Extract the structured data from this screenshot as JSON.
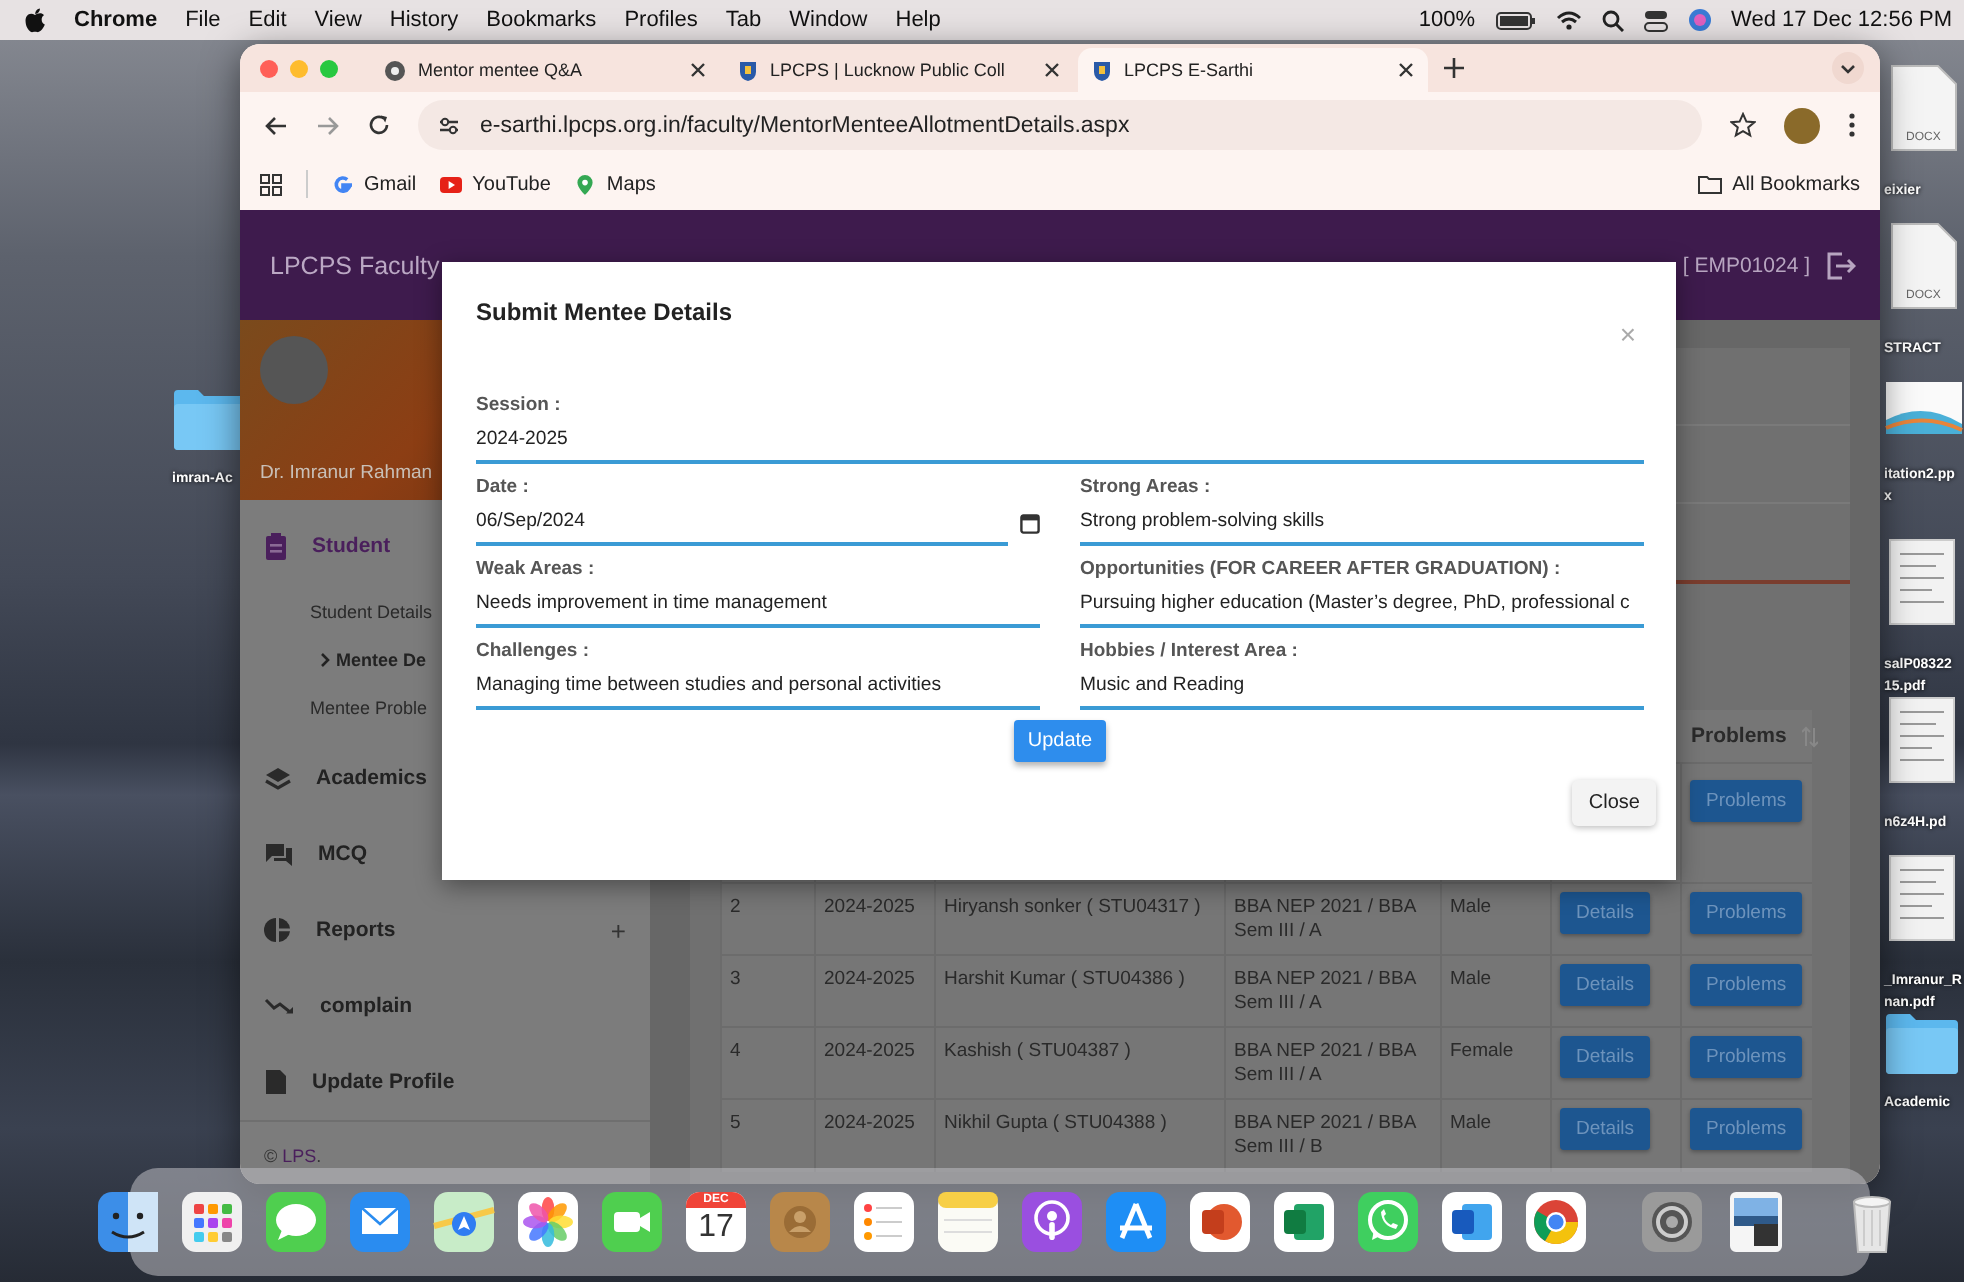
{
  "menu_bar": {
    "app": "Chrome",
    "menus": [
      "File",
      "Edit",
      "View",
      "History",
      "Bookmarks",
      "Profiles",
      "Tab",
      "Window",
      "Help"
    ],
    "battery": "100%",
    "clock": "Wed 17 Dec  12:56 PM"
  },
  "desktop_left": [
    {
      "kind": "folder",
      "label": [
        "imran-Ac"
      ]
    }
  ],
  "desktop_right": [
    {
      "kind": "doc",
      "badge": "DOCX",
      "label": [
        "eixier"
      ]
    },
    {
      "kind": "doc",
      "badge": "DOCX",
      "label": [
        "STRACT"
      ]
    },
    {
      "kind": "slides",
      "label": [
        "itation2.pp",
        "x"
      ]
    },
    {
      "kind": "pdf",
      "label": [
        "salP08322",
        "15.pdf"
      ]
    },
    {
      "kind": "pdf",
      "label": [
        "n6z4H.pd"
      ]
    },
    {
      "kind": "pdf",
      "label": [
        "_Imranur_R",
        "nan.pdf"
      ]
    },
    {
      "kind": "folder",
      "label": [
        "Academic"
      ]
    }
  ],
  "browser": {
    "tabs": [
      {
        "title": "Mentor mentee Q&A",
        "selected": false
      },
      {
        "title": "LPCPS | Lucknow Public Coll",
        "selected": false
      },
      {
        "title": "LPCPS E-Sarthi",
        "selected": true
      }
    ],
    "url": "e-sarthi.lpcps.org.in/faculty/MentorMenteeAllotmentDetails.aspx",
    "bookmarks": [
      "Gmail",
      "YouTube",
      "Maps"
    ],
    "all_bookmarks": "All Bookmarks"
  },
  "page": {
    "brand": "LPCPS Faculty",
    "user_id": "[ EMP01024 ]",
    "profile_name": "Dr. Imranur Rahman",
    "sidebar": [
      {
        "label": "Student",
        "selected": true,
        "children": [
          {
            "label": "Student Details",
            "selected": false
          },
          {
            "label": "Mentee De",
            "selected": true
          },
          {
            "label": "Mentee Proble",
            "selected": false
          }
        ]
      },
      {
        "label": "Academics",
        "selected": false
      },
      {
        "label": "MCQ",
        "selected": false
      },
      {
        "label": "Reports",
        "selected": false,
        "toggle": "+"
      },
      {
        "label": "complain",
        "selected": false
      },
      {
        "label": "Update Profile",
        "selected": false
      }
    ],
    "footer": {
      "prefix": "©",
      "link": "LPS",
      "suffix": "."
    },
    "table": {
      "problems_header": "Problems",
      "rows": [
        {
          "problems": "Problems"
        },
        {
          "number": "2",
          "session": "2024-2025",
          "name": "Hiryansh sonker ( STU04317 )",
          "class": "BBA NEP 2021 / BBA Sem III / A",
          "gender": "Male",
          "details": "Details",
          "problems": "Problems"
        },
        {
          "number": "3",
          "session": "2024-2025",
          "name": "Harshit Kumar ( STU04386 )",
          "class": "BBA NEP 2021 / BBA Sem III / A",
          "gender": "Male",
          "details": "Details",
          "problems": "Problems"
        },
        {
          "number": "4",
          "session": "2024-2025",
          "name": "Kashish ( STU04387 )",
          "class": "BBA NEP 2021 / BBA Sem III / A",
          "gender": "Female",
          "details": "Details",
          "problems": "Problems"
        },
        {
          "number": "5",
          "session": "2024-2025",
          "name": "Nikhil Gupta ( STU04388 )",
          "class": "BBA NEP 2021 / BBA Sem III / B",
          "gender": "Male",
          "details": "Details",
          "problems": "Problems"
        }
      ]
    }
  },
  "modal": {
    "title": "Submit Mentee Details",
    "close_glyph": "×",
    "fields": [
      {
        "label": "Session :",
        "value": "2024-2025",
        "kind": "text",
        "wide": true
      },
      {
        "label": "Date :",
        "value": "06/Sep/2024",
        "kind": "date",
        "wide": false
      },
      {
        "label": "Strong Areas :",
        "value": "Strong problem-solving skills",
        "kind": "text",
        "wide": false
      },
      {
        "label": "Weak Areas :",
        "value": "Needs improvement in time management",
        "kind": "text",
        "wide": false
      },
      {
        "label": "Opportunities (FOR CAREER AFTER GRADUATION) :",
        "value": "Pursuing higher education (Master’s degree, PhD, professional c",
        "kind": "text",
        "wide": false
      },
      {
        "label": "Challenges :",
        "value": "Managing time between studies and personal activities",
        "kind": "text",
        "wide": false
      },
      {
        "label": "Hobbies / Interest Area :",
        "value": "Music and Reading",
        "kind": "text",
        "wide": false
      }
    ],
    "update": "Update",
    "close": "Close"
  },
  "dock": {
    "calendar_month": "DEC",
    "calendar_day": "17"
  }
}
